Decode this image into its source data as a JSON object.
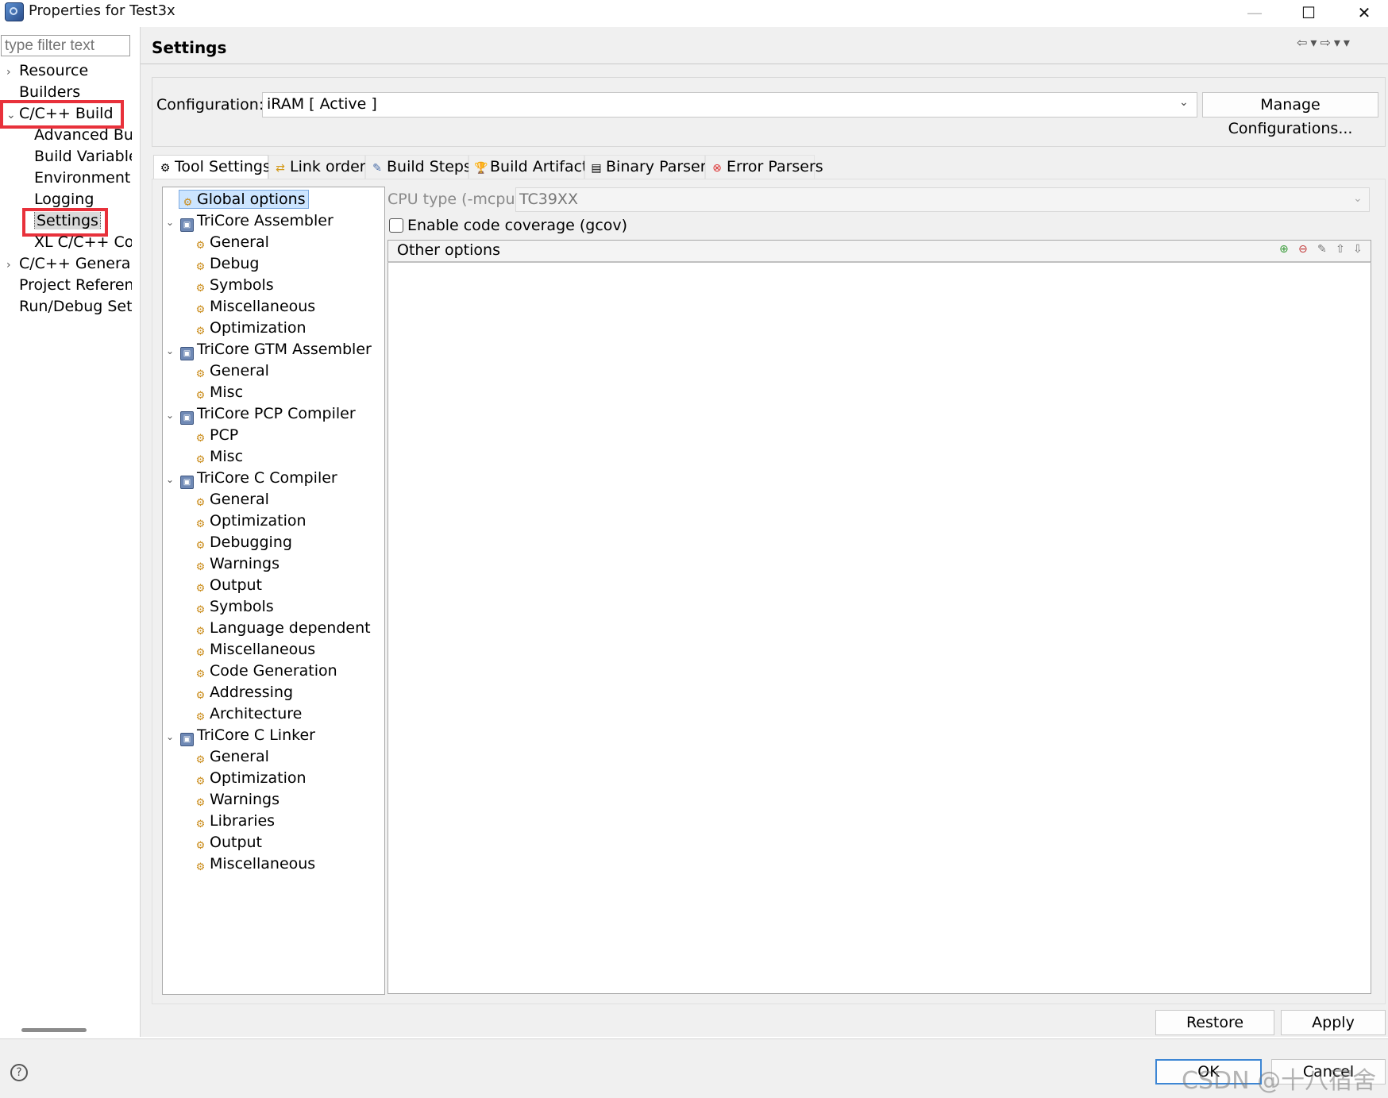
{
  "window": {
    "title": "Properties for Test3x",
    "minimize": "—",
    "maximize": "☐",
    "close": "✕"
  },
  "filter": {
    "placeholder": "type filter text"
  },
  "nav": [
    {
      "label": "Resource",
      "indent": 0,
      "chevron": "›"
    },
    {
      "label": "Builders",
      "indent": 0
    },
    {
      "label": "C/C++ Build",
      "indent": 0,
      "chevron": "⌄",
      "highlighted": true
    },
    {
      "label": "Advanced Buil",
      "indent": 1
    },
    {
      "label": "Build Variables",
      "indent": 1
    },
    {
      "label": "Environment",
      "indent": 1
    },
    {
      "label": "Logging",
      "indent": 1
    },
    {
      "label": "Settings",
      "indent": 1,
      "selected": true,
      "highlighted": true
    },
    {
      "label": "XL C/C++ Com",
      "indent": 1
    },
    {
      "label": "C/C++ General",
      "indent": 0,
      "chevron": "›"
    },
    {
      "label": "Project Reference",
      "indent": 0
    },
    {
      "label": "Run/Debug Setti",
      "indent": 0
    }
  ],
  "page": {
    "title": "Settings",
    "history_icons": "⇦▾⇨▾▾"
  },
  "configuration": {
    "label": "Configuration:",
    "value": "iRAM  [ Active ]",
    "manage_button": "Manage Configurations..."
  },
  "tabs": [
    {
      "label": "Tool Settings",
      "icon": "tool-settings-icon",
      "glyph": "⚙",
      "active": true
    },
    {
      "label": "Link order",
      "icon": "link-order-icon",
      "glyph": "⇄"
    },
    {
      "label": "Build Steps",
      "icon": "build-steps-icon",
      "glyph": "✎"
    },
    {
      "label": "Build Artifact",
      "icon": "build-artifact-icon",
      "glyph": "🏆"
    },
    {
      "label": "Binary Parsers",
      "icon": "binary-parsers-icon",
      "glyph": "▤"
    },
    {
      "label": "Error Parsers",
      "icon": "error-parsers-icon",
      "glyph": "⊗"
    }
  ],
  "tree": {
    "global": "Global options",
    "groups": [
      {
        "label": "TriCore Assembler",
        "children": [
          "General",
          "Debug",
          "Symbols",
          "Miscellaneous",
          "Optimization"
        ]
      },
      {
        "label": "TriCore GTM Assembler",
        "children": [
          "General",
          "Misc"
        ]
      },
      {
        "label": "TriCore PCP Compiler",
        "children": [
          "PCP",
          "Misc"
        ]
      },
      {
        "label": "TriCore C Compiler",
        "children": [
          "General",
          "Optimization",
          "Debugging",
          "Warnings",
          "Output",
          "Symbols",
          "Language dependent",
          "Miscellaneous",
          "Code Generation",
          "Addressing",
          "Architecture"
        ]
      },
      {
        "label": "TriCore C Linker",
        "children": [
          "General",
          "Optimization",
          "Warnings",
          "Libraries",
          "Output",
          "Miscellaneous"
        ]
      }
    ]
  },
  "options": {
    "cpu_label": "CPU type (-mcpu)",
    "cpu_value": "TC39XX",
    "coverage_label": "Enable code coverage (gcov)",
    "coverage_checked": false,
    "other_options_title": "Other options",
    "other_options_tools": [
      "add-icon",
      "delete-icon",
      "edit-icon",
      "move-up-icon",
      "move-down-icon"
    ]
  },
  "buttons": {
    "restore_defaults": "Restore Defaults",
    "apply": "Apply",
    "ok": "OK",
    "cancel": "Cancel",
    "help": "?"
  },
  "watermark": "CSDN @十八宿舍",
  "colors": {
    "highlight_box": "#e8313b",
    "selection": "#cce5ff",
    "ok_border": "#3d86d4"
  }
}
